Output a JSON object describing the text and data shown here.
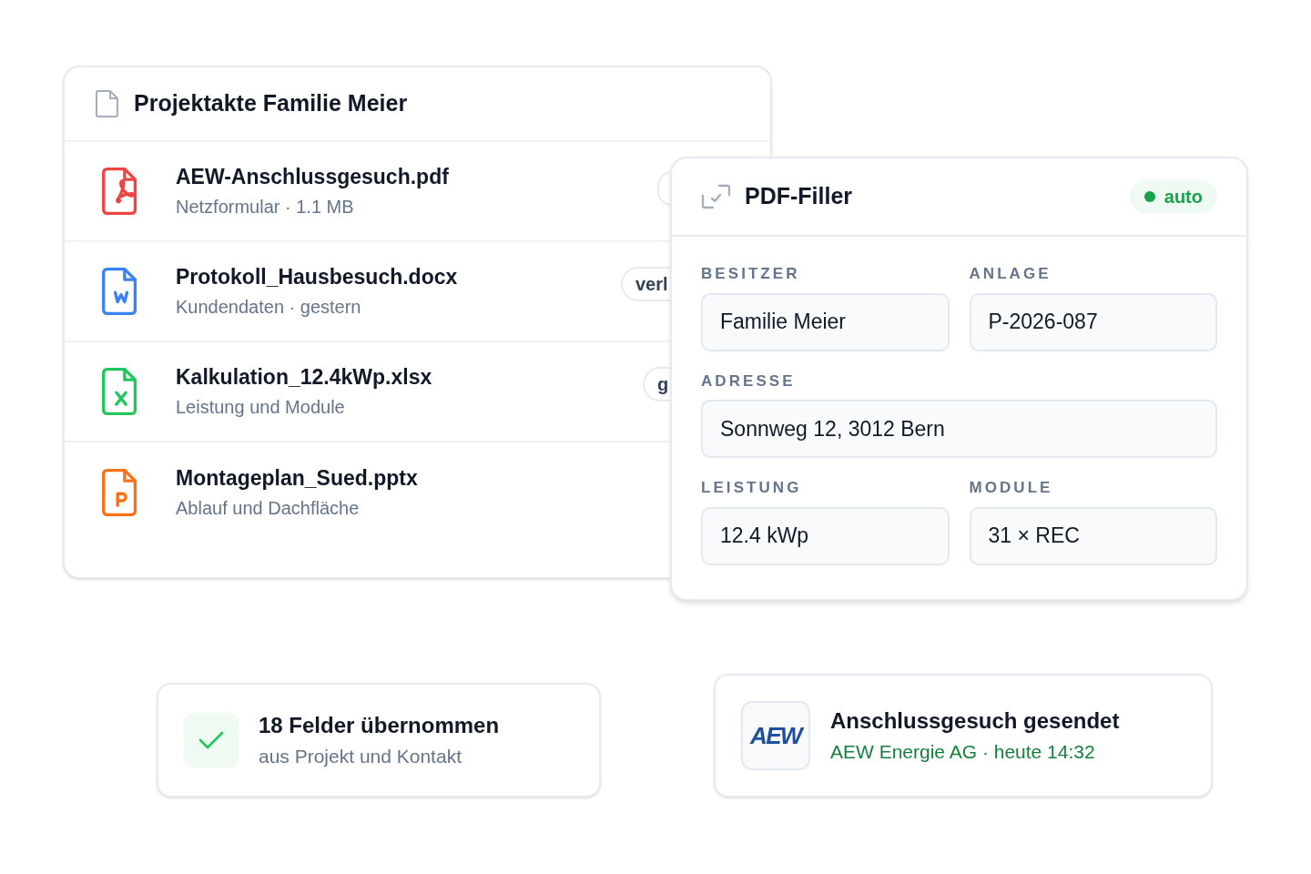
{
  "project_card": {
    "title": "Projektakte Familie Meier",
    "files": [
      {
        "kind": "pdf",
        "name": "AEW-Anschlussgesuch.pdf",
        "meta": "Netzformular · 1.1 MB",
        "has_tag": true
      },
      {
        "kind": "docx",
        "name": "Protokoll_Hausbesuch.docx",
        "meta": "Kundendaten · gestern",
        "has_tag": true,
        "tag": "verl"
      },
      {
        "kind": "xlsx",
        "name": "Kalkulation_12.4kWp.xlsx",
        "meta": "Leistung und Module",
        "has_tag": true,
        "tag": "g"
      },
      {
        "kind": "pptx",
        "name": "Montageplan_Sued.pptx",
        "meta": "Ablauf und Dachfläche",
        "has_tag": false
      }
    ]
  },
  "filler_card": {
    "title": "PDF-Filler",
    "status": {
      "label": "auto",
      "color": "#16a34a"
    },
    "fields": [
      {
        "label": "BESITZER",
        "value": "Familie Meier",
        "wide": false
      },
      {
        "label": "ANLAGE",
        "value": "P-2026-087",
        "wide": false
      },
      {
        "label": "ADRESSE",
        "value": "Sonnweg 12, 3012 Bern",
        "wide": true
      },
      {
        "label": "LEISTUNG",
        "value": "12.4 kWp",
        "wide": false
      },
      {
        "label": "MODULE",
        "value": "31 × REC",
        "wide": false
      }
    ]
  },
  "notifications": [
    {
      "kind": "check",
      "title": "18 Felder übernommen",
      "subtitle": "aus Projekt und Kontakt"
    },
    {
      "kind": "logo",
      "logo": "AEW",
      "title": "Anschlussgesuch gesendet",
      "subtitle": "AEW Energie AG · heute 14:32"
    }
  ]
}
